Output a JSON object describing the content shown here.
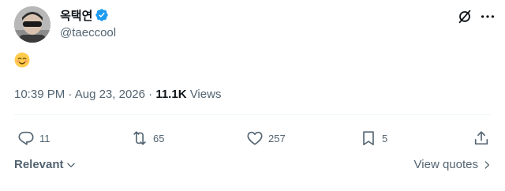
{
  "author": {
    "display_name": "옥택연",
    "handle": "@taeccool",
    "verified_color": "#1d9bf0"
  },
  "tweet": {
    "emoji_icon": "smiling-face-with-smiling-eyes-icon"
  },
  "meta": {
    "time": "10:39 PM",
    "date": "Aug 23, 2026",
    "views_count": "11.1K",
    "views_label": "Views",
    "separator_1": " · ",
    "separator_2": " · "
  },
  "actions": {
    "reply_count": "11",
    "retweet_count": "65",
    "like_count": "257",
    "bookmark_count": "5"
  },
  "footer": {
    "sort_label": "Relevant",
    "view_quotes_label": "View quotes"
  },
  "colors": {
    "text_primary": "#0f1419",
    "text_secondary": "#536471",
    "verified": "#1d9bf0",
    "divider": "#eff3f4"
  }
}
